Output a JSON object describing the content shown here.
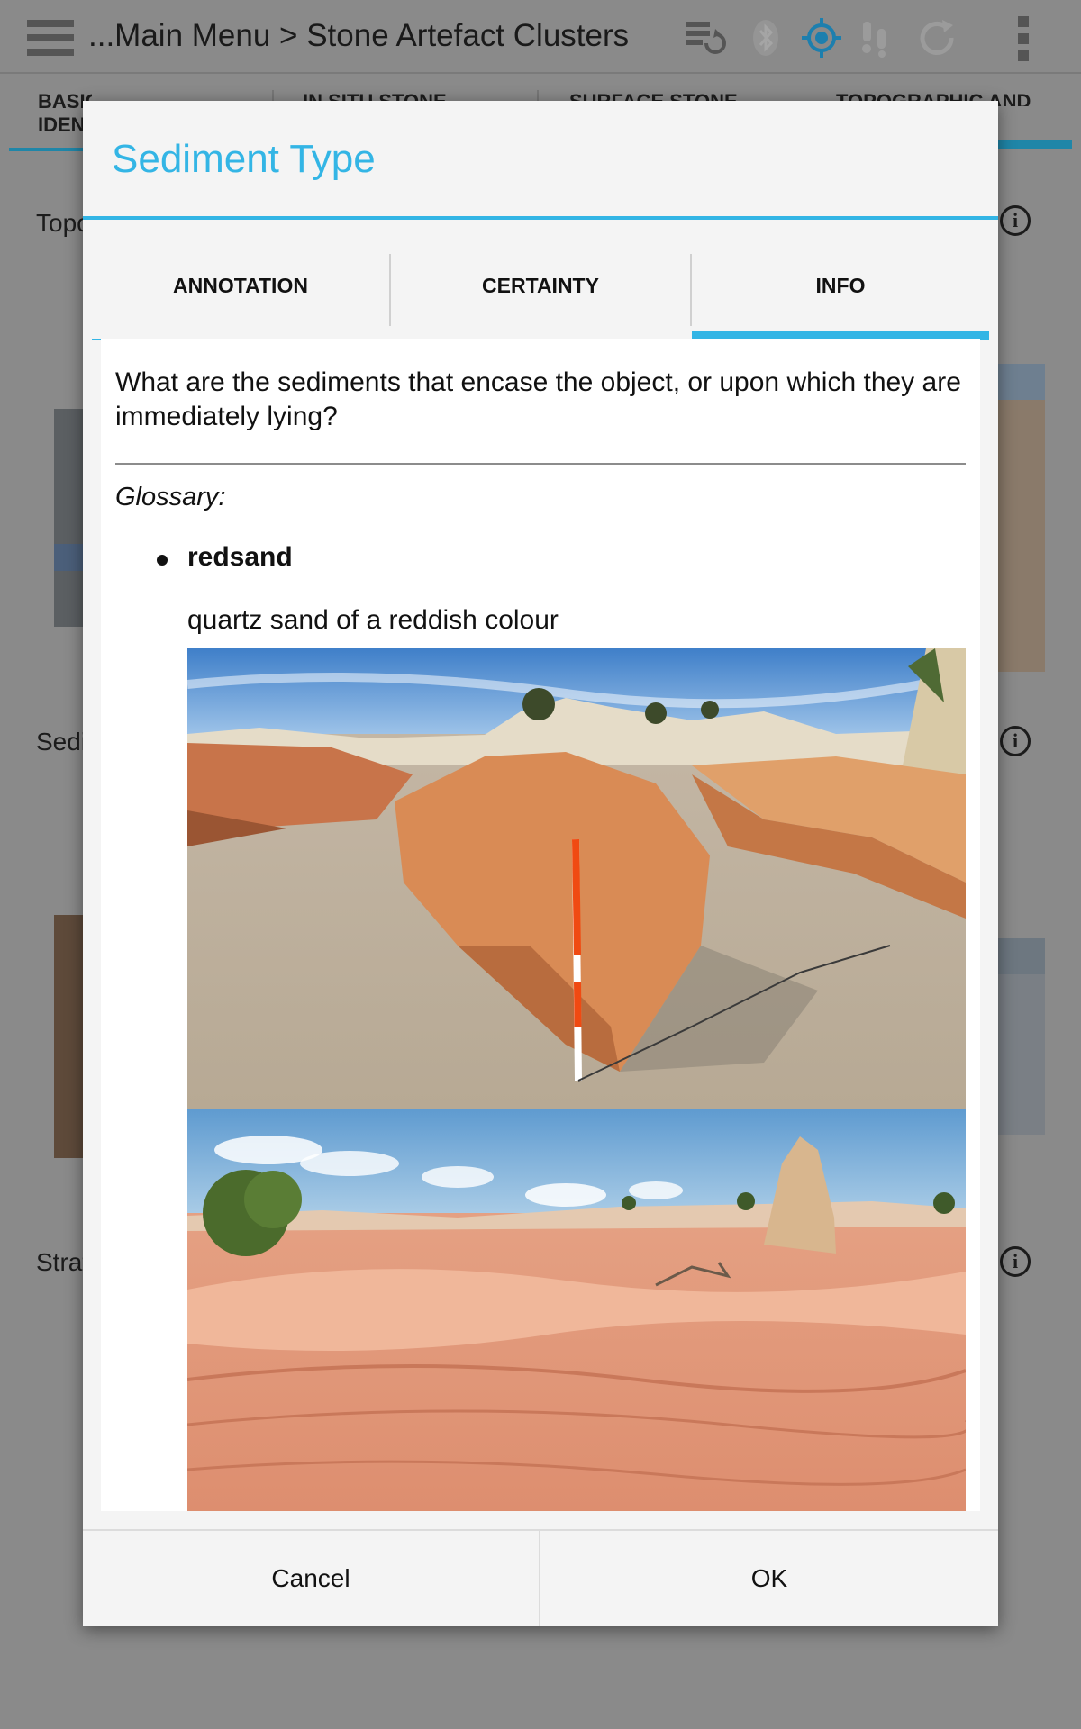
{
  "app": {
    "breadcrumb": "...Main Menu > Stone Artefact Clusters",
    "icons": [
      "sync-status-icon",
      "bluetooth-icon",
      "gps-icon",
      "wifi-icon",
      "refresh-icon",
      "overflow-menu-icon"
    ]
  },
  "background_tabs": [
    {
      "label": "BASIC IDEN"
    },
    {
      "label": "IN SITU STONE"
    },
    {
      "label": "SURFACE STONE"
    },
    {
      "label": "TOPOGRAPHIC AND"
    }
  ],
  "background_fields": [
    {
      "label": "Topo"
    },
    {
      "label": "Sedi"
    },
    {
      "label": "Strat"
    }
  ],
  "dialog": {
    "title": "Sediment Type",
    "tabs": [
      {
        "label": "ANNOTATION",
        "active": false
      },
      {
        "label": "CERTAINTY",
        "active": false
      },
      {
        "label": "INFO",
        "active": true
      }
    ],
    "info": {
      "question": "What are the sediments that encase the object, or upon which they are immediately lying?",
      "glossary_heading": "Glossary:",
      "terms": [
        {
          "term": "redsand",
          "definition": "quartz sand of a reddish colour"
        }
      ]
    },
    "buttons": {
      "cancel": "Cancel",
      "ok": "OK"
    }
  },
  "colors": {
    "accent": "#33b5e5",
    "scrim": "#8a8a8a",
    "dialog_bg": "#f4f4f4"
  }
}
